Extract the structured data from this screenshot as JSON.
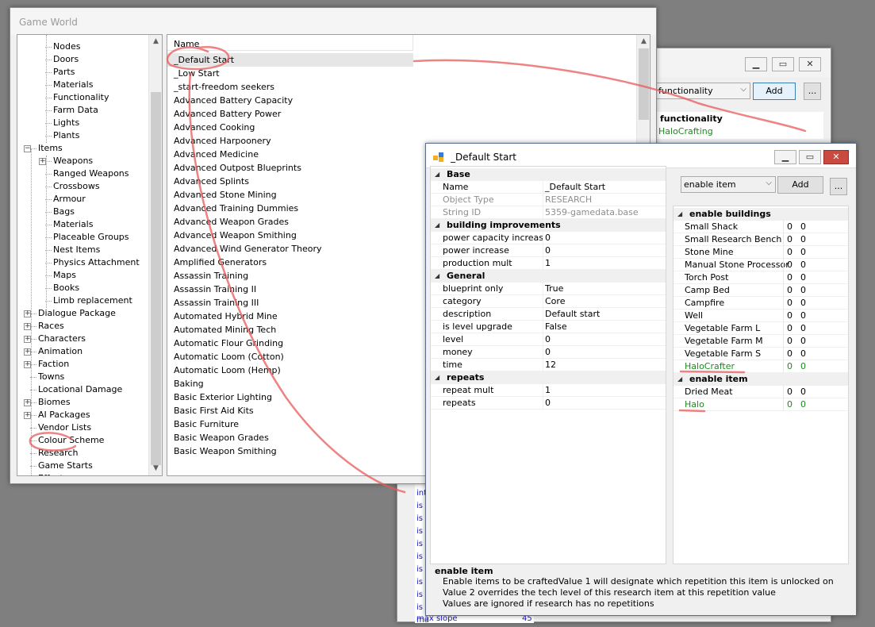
{
  "game_world": {
    "title": "Game World",
    "tree": [
      {
        "label": "Nodes",
        "level": 2
      },
      {
        "label": "Doors",
        "level": 2
      },
      {
        "label": "Parts",
        "level": 2
      },
      {
        "label": "Materials",
        "level": 2
      },
      {
        "label": "Functionality",
        "level": 2
      },
      {
        "label": "Farm Data",
        "level": 2
      },
      {
        "label": "Lights",
        "level": 2
      },
      {
        "label": "Plants",
        "level": 2
      },
      {
        "label": "Items",
        "level": 1,
        "expander": "−"
      },
      {
        "label": "Weapons",
        "level": 2,
        "expander": "+"
      },
      {
        "label": "Ranged Weapons",
        "level": 2
      },
      {
        "label": "Crossbows",
        "level": 2
      },
      {
        "label": "Armour",
        "level": 2
      },
      {
        "label": "Bags",
        "level": 2
      },
      {
        "label": "Materials",
        "level": 2
      },
      {
        "label": "Placeable Groups",
        "level": 2
      },
      {
        "label": "Nest Items",
        "level": 2
      },
      {
        "label": "Physics Attachment",
        "level": 2
      },
      {
        "label": "Maps",
        "level": 2
      },
      {
        "label": "Books",
        "level": 2
      },
      {
        "label": "Limb replacement",
        "level": 2
      },
      {
        "label": "Dialogue Package",
        "level": 1,
        "expander": "+"
      },
      {
        "label": "Races",
        "level": 1,
        "expander": "+"
      },
      {
        "label": "Characters",
        "level": 1,
        "expander": "+"
      },
      {
        "label": "Animation",
        "level": 1,
        "expander": "+"
      },
      {
        "label": "Faction",
        "level": 1,
        "expander": "+"
      },
      {
        "label": "Towns",
        "level": 1
      },
      {
        "label": "Locational Damage",
        "level": 1
      },
      {
        "label": "Biomes",
        "level": 1,
        "expander": "+"
      },
      {
        "label": "AI Packages",
        "level": 1,
        "expander": "+"
      },
      {
        "label": "Vendor Lists",
        "level": 1
      },
      {
        "label": "Colour Scheme",
        "level": 1
      },
      {
        "label": "Research",
        "level": 1
      },
      {
        "label": "Game Starts",
        "level": 1
      },
      {
        "label": "Effects",
        "level": 1,
        "expander": "+"
      }
    ],
    "list_header": "Name",
    "list_items": [
      "_Default Start",
      "_Low Start",
      "_start-freedom seekers",
      "Advanced Battery Capacity",
      "Advanced Battery Power",
      "Advanced Cooking",
      "Advanced Harpoonery",
      "Advanced Medicine",
      "Advanced Outpost Blueprints",
      "Advanced Splints",
      "Advanced Stone Mining",
      "Advanced Training Dummies",
      "Advanced Weapon Grades",
      "Advanced Weapon Smithing",
      "Advanced Wind Generator Theory",
      "Amplified Generators",
      "Assassin Training",
      "Assassin Training II",
      "Assassin Training III",
      "Automated Hybrid Mine",
      "Automated Mining Tech",
      "Automatic Flour Grinding",
      "Automatic Loom (Cotton)",
      "Automatic Loom (Hemp)",
      "Baking",
      "Basic Exterior Lighting",
      "Basic First Aid Kits",
      "Basic Furniture",
      "Basic Weapon Grades",
      "Basic Weapon Smithing"
    ],
    "selected_item": "_Default Start"
  },
  "back_window": {
    "combo_value": "functionality",
    "add_label": "Add",
    "more_label": "...",
    "section_title": "functionality",
    "green_item": "HaloCrafting",
    "partial_list": [
      "int",
      "is",
      "is",
      "is",
      "is",
      "is",
      "is",
      "is",
      "is",
      "is",
      "ma"
    ],
    "bottom_row_key": "max slope",
    "bottom_row_value": "45"
  },
  "default_start": {
    "title": "_Default Start",
    "sections": [
      {
        "name": "Base",
        "rows": [
          {
            "k": "Name",
            "v": "_Default Start",
            "gray": false
          },
          {
            "k": "Object Type",
            "v": "RESEARCH",
            "gray": true
          },
          {
            "k": "String ID",
            "v": "5359-gamedata.base",
            "gray": true
          }
        ]
      },
      {
        "name": "building improvements",
        "rows": [
          {
            "k": "power capacity increase",
            "v": "0"
          },
          {
            "k": "power increase",
            "v": "0"
          },
          {
            "k": "production mult",
            "v": "1"
          }
        ]
      },
      {
        "name": "General",
        "rows": [
          {
            "k": "blueprint only",
            "v": "True"
          },
          {
            "k": "category",
            "v": "Core"
          },
          {
            "k": "description",
            "v": "Default start"
          },
          {
            "k": "is level upgrade",
            "v": "False"
          },
          {
            "k": "level",
            "v": "0"
          },
          {
            "k": "money",
            "v": "0"
          },
          {
            "k": "time",
            "v": "12"
          }
        ]
      },
      {
        "name": "repeats",
        "rows": [
          {
            "k": "repeat mult",
            "v": "1"
          },
          {
            "k": "repeats",
            "v": "0"
          }
        ]
      }
    ],
    "combo_value": "enable item",
    "add_label": "Add",
    "more_label": "...",
    "ref_sections": [
      {
        "name": "enable buildings",
        "rows": [
          {
            "k": "Small Shack",
            "a": "0",
            "b": "0"
          },
          {
            "k": "Small Research Bench",
            "a": "0",
            "b": "0"
          },
          {
            "k": "Stone Mine",
            "a": "0",
            "b": "0"
          },
          {
            "k": "Manual Stone Processor",
            "a": "0",
            "b": "0"
          },
          {
            "k": "Torch Post",
            "a": "0",
            "b": "0"
          },
          {
            "k": "Camp Bed",
            "a": "0",
            "b": "0"
          },
          {
            "k": "Campfire",
            "a": "0",
            "b": "0"
          },
          {
            "k": "Well",
            "a": "0",
            "b": "0"
          },
          {
            "k": "Vegetable Farm L",
            "a": "0",
            "b": "0"
          },
          {
            "k": "Vegetable Farm M",
            "a": "0",
            "b": "0"
          },
          {
            "k": "Vegetable Farm S",
            "a": "0",
            "b": "0"
          },
          {
            "k": "HaloCrafter",
            "a": "0",
            "b": "0",
            "green": true
          }
        ]
      },
      {
        "name": "enable item",
        "rows": [
          {
            "k": "Dried Meat",
            "a": "0",
            "b": "0"
          },
          {
            "k": "Halo",
            "a": "0",
            "b": "0",
            "green": true
          }
        ]
      }
    ],
    "description": {
      "title": "enable item",
      "lines": [
        "Enable items to be craftedValue 1 will designate which repetition this item is unlocked on",
        "Value 2 overrides the tech level of this research item at this repetition value",
        "Values are ignored if research has no repetitions"
      ]
    }
  },
  "colors": {
    "annotation": "#e85a5a",
    "link_blue": "#1a1ad0",
    "green": "#1e8a1e"
  }
}
